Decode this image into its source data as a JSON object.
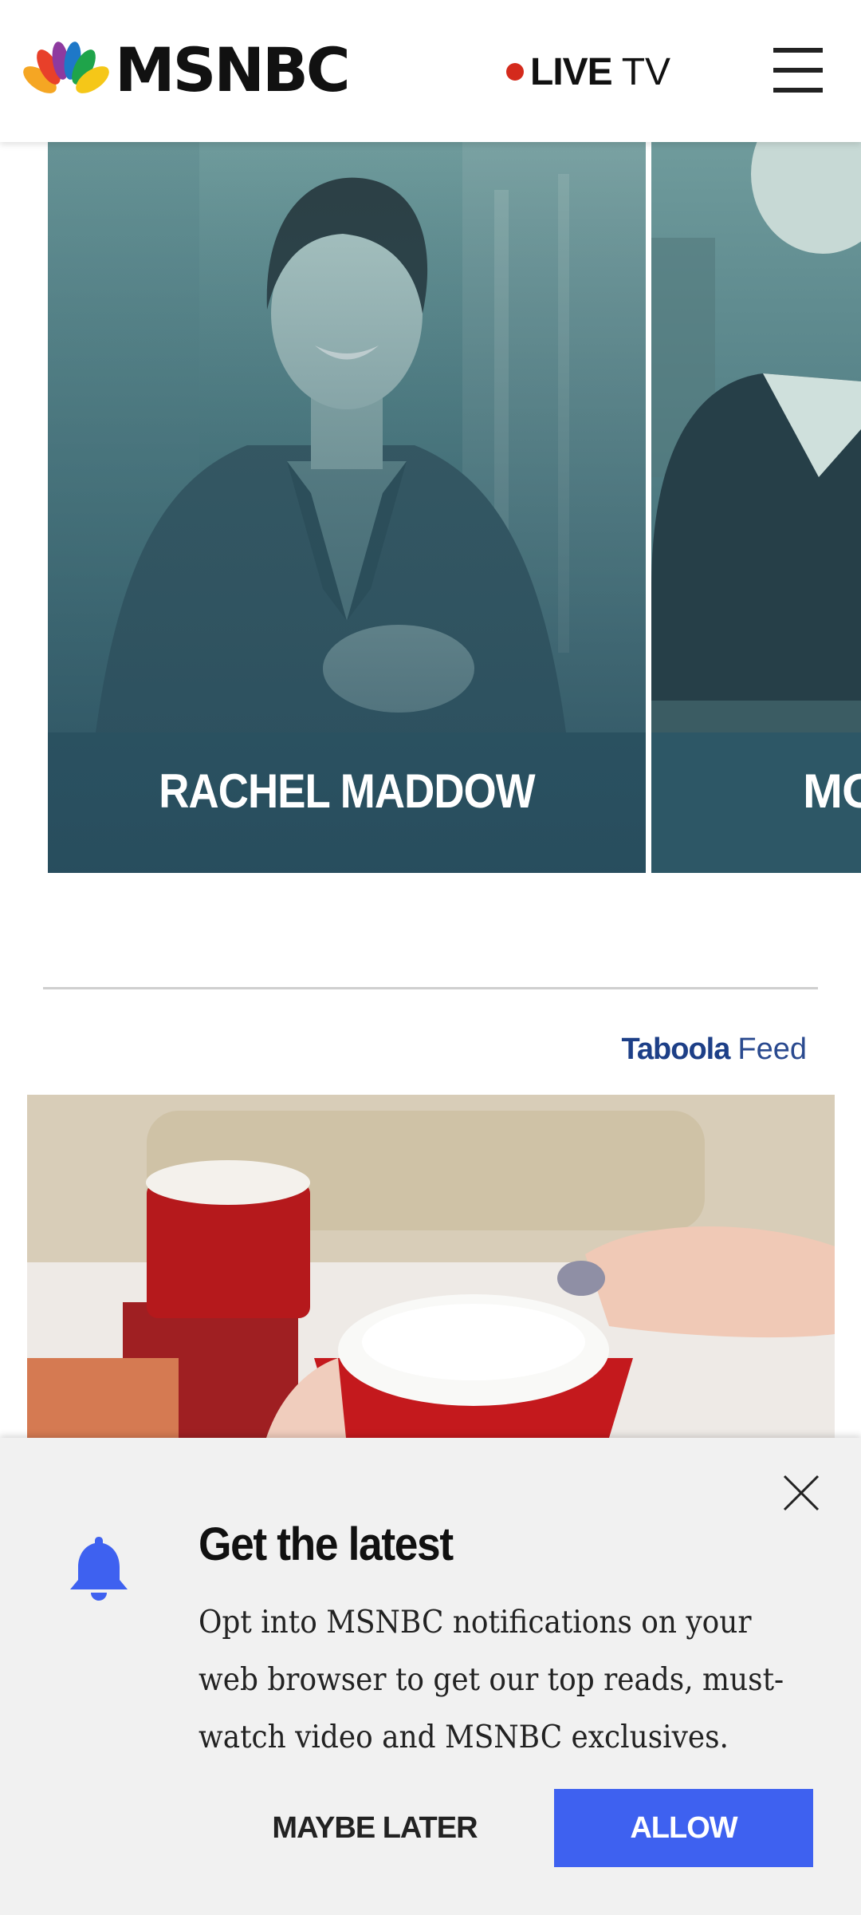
{
  "header": {
    "logo_text": "MSNBC",
    "live_label": "LIVE",
    "tv_label": "TV"
  },
  "hosts": [
    {
      "name": "RACHEL MADDOW"
    },
    {
      "name": "MO"
    }
  ],
  "taboola": {
    "logo_text": "Taboola",
    "feed_label": "Feed"
  },
  "notification": {
    "title": "Get the latest",
    "body": "Opt into MSNBC notifications on your web browser to get our top reads, must-watch video and MSNBC exclusives.",
    "maybe_later_label": "MAYBE LATER",
    "allow_label": "ALLOW"
  },
  "colors": {
    "live_dot": "#d42a1c",
    "allow_button": "#3e61f0",
    "bell": "#3e61f0",
    "card_overlay": "#2e6a70"
  },
  "icons": [
    "msnbc-peacock-icon",
    "live-dot-icon",
    "hamburger-menu-icon",
    "close-icon",
    "bell-icon"
  ]
}
